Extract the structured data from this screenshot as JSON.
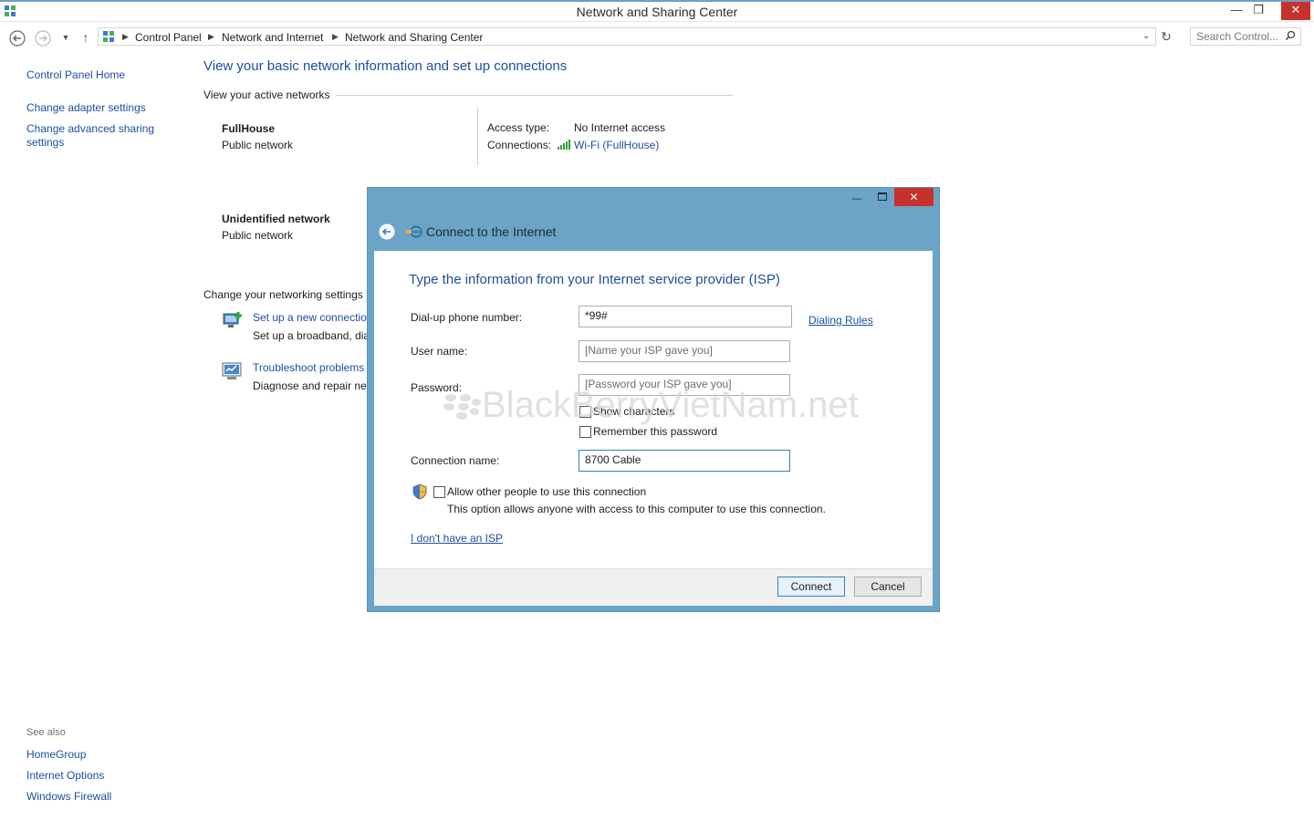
{
  "window": {
    "title": "Network and Sharing Center"
  },
  "address": {
    "crumbs": [
      "Control Panel",
      "Network and Internet",
      "Network and Sharing Center"
    ],
    "search_placeholder": "Search Control..."
  },
  "left_panel": {
    "home": "Control Panel Home",
    "adapter": "Change adapter settings",
    "advanced_line1": "Change advanced sharing",
    "advanced_line2": "settings",
    "see_also": "See also",
    "homegroup": "HomeGroup",
    "internet_options": "Internet Options",
    "firewall": "Windows Firewall"
  },
  "main": {
    "heading": "View your basic network information and set up connections",
    "active_networks": "View your active networks",
    "net1": {
      "name": "FullHouse",
      "type": "Public network",
      "access_label": "Access type:",
      "access_value": "No Internet access",
      "connections_label": "Connections:",
      "connections_value": "Wi-Fi (FullHouse)"
    },
    "net2": {
      "name": "Unidentified network",
      "type": "Public network"
    },
    "change_settings": "Change your networking settings",
    "setup_title": "Set up a new connection",
    "setup_desc": "Set up a broadband, dia",
    "troubleshoot_title": "Troubleshoot problems",
    "troubleshoot_desc": "Diagnose and repair net"
  },
  "dialog": {
    "title": "Connect to the Internet",
    "heading": "Type the information from your Internet service provider (ISP)",
    "phone_label": "Dial-up phone number:",
    "phone_value": "*99#",
    "dialing_rules": "Dialing Rules",
    "user_label": "User name:",
    "user_placeholder": "[Name your ISP gave you]",
    "pass_label": "Password:",
    "pass_placeholder": "[Password your ISP gave you]",
    "show_chars": "Show characters",
    "remember": "Remember this password",
    "conn_name_label": "Connection name:",
    "conn_name_value": "8700 Cable",
    "allow_label": "Allow other people to use this connection",
    "allow_desc": "This option allows anyone with access to this computer to use this connection.",
    "no_isp": "I don't have an ISP",
    "connect": "Connect",
    "cancel": "Cancel"
  },
  "watermark": "BlackBerryVietNam.net"
}
